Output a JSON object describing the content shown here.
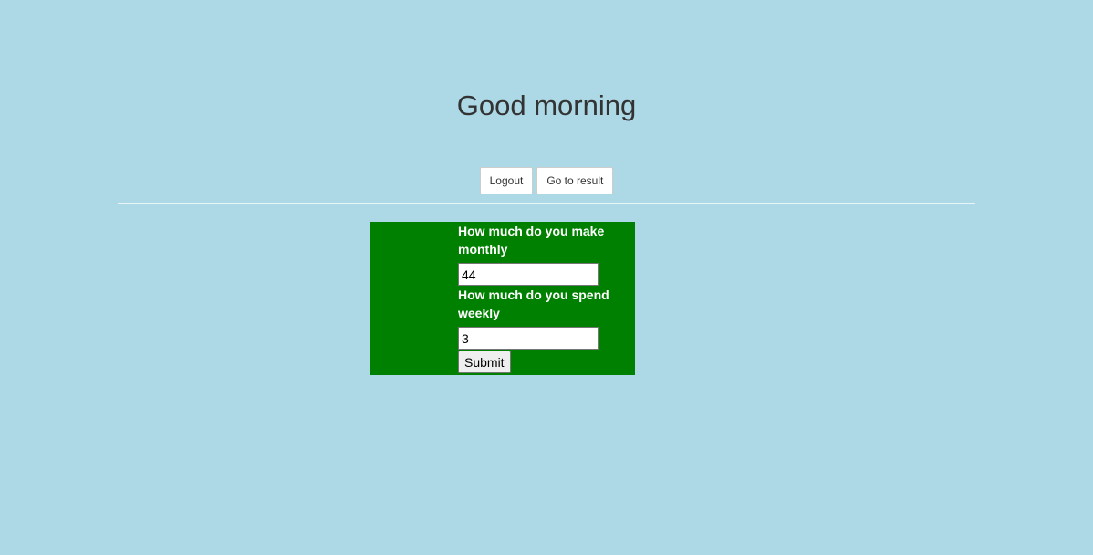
{
  "header": {
    "title": "Good morning"
  },
  "nav": {
    "logout_label": "Logout",
    "result_label": "Go to result"
  },
  "form": {
    "income": {
      "label": "How much do you make monthly",
      "value": "44"
    },
    "spending": {
      "label": "How much do you spend weekly",
      "value": "3"
    },
    "submit_label": "Submit"
  },
  "colors": {
    "page_background": "#add8e6",
    "form_background": "#008000",
    "title_text": "#333333",
    "label_text": "#ffffff"
  }
}
